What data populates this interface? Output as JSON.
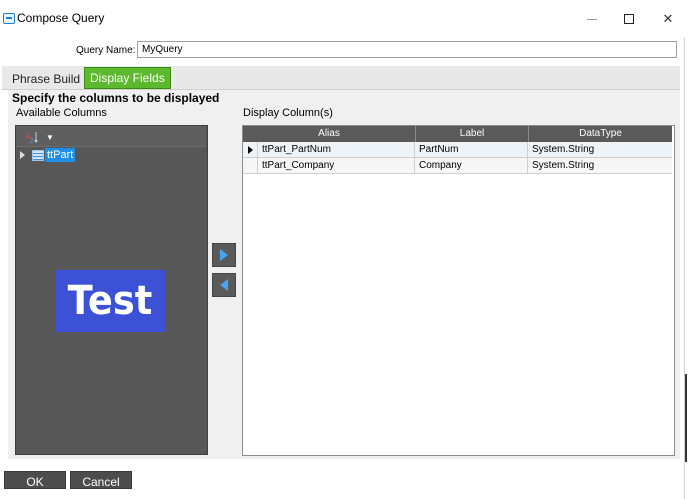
{
  "window": {
    "title": "Compose Query",
    "controls": {
      "minimize": "minimize",
      "maximize": "maximize",
      "close": "✕"
    }
  },
  "query": {
    "name_label": "Query Name:",
    "name_value": "MyQuery"
  },
  "tabs": [
    {
      "label": "Phrase Build",
      "active": false
    },
    {
      "label": "Display Fields",
      "active": true
    }
  ],
  "colors": {
    "active_tab": "#5cb82d",
    "tree_background": "#575757",
    "grid_header": "#5a5a5a",
    "selection": "#1e90e8",
    "logo": "#3d51d6"
  },
  "panel": {
    "heading": "Specify the columns to be displayed",
    "available_label": "Available Columns",
    "display_label": "Display Column(s)"
  },
  "tree": {
    "toolbar_icons": [
      "sort-icon",
      "chevron-down-icon"
    ],
    "nodes": [
      {
        "label": "ttPart",
        "icon": "table-icon",
        "selected": true,
        "expanded": false
      }
    ],
    "watermark": "Test"
  },
  "move_buttons": {
    "add": "arrow-right-icon",
    "remove": "arrow-left-icon"
  },
  "grid": {
    "columns": [
      "Alias",
      "Label",
      "DataType"
    ],
    "rows": [
      {
        "alias": "ttPart_PartNum",
        "label": "PartNum",
        "datatype": "System.String",
        "current": true
      },
      {
        "alias": "ttPart_Company",
        "label": "Company",
        "datatype": "System.String",
        "current": false
      }
    ]
  },
  "buttons": {
    "ok": "OK",
    "cancel": "Cancel"
  }
}
